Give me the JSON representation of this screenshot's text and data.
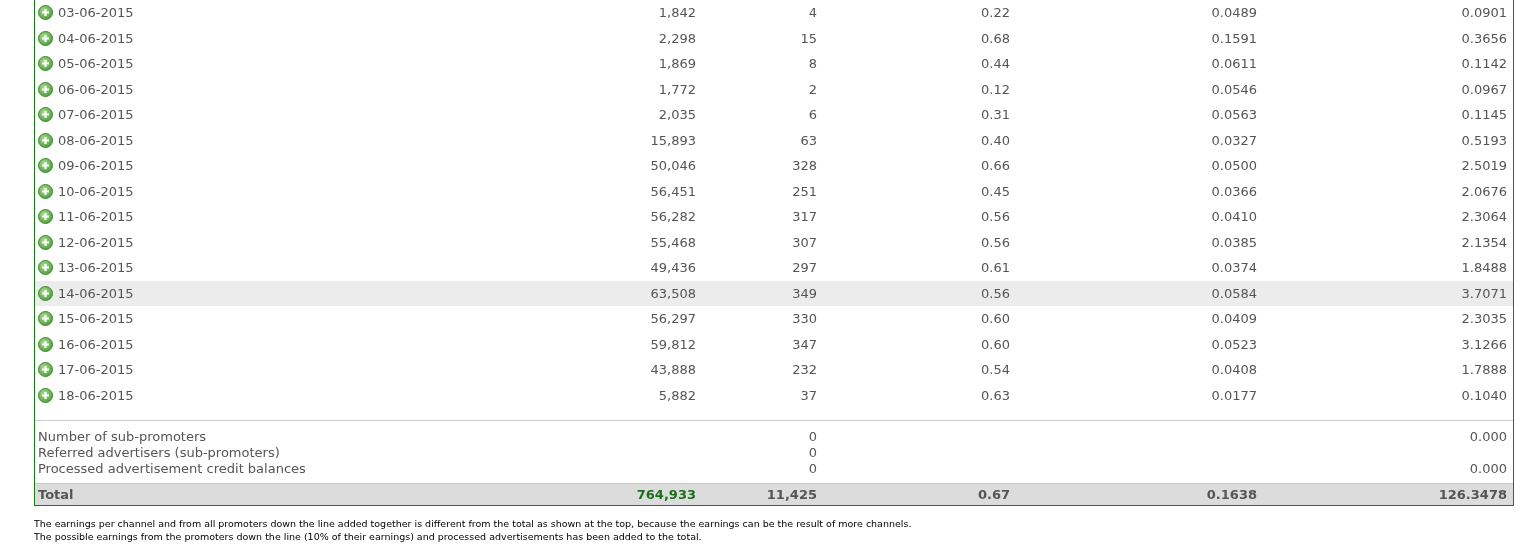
{
  "rows": [
    {
      "date": "03-06-2015",
      "cells": [
        "1,842",
        "4",
        "0.22",
        "0.0489",
        "0.0901"
      ],
      "highlighted": false
    },
    {
      "date": "04-06-2015",
      "cells": [
        "2,298",
        "15",
        "0.68",
        "0.1591",
        "0.3656"
      ],
      "highlighted": false
    },
    {
      "date": "05-06-2015",
      "cells": [
        "1,869",
        "8",
        "0.44",
        "0.0611",
        "0.1142"
      ],
      "highlighted": false
    },
    {
      "date": "06-06-2015",
      "cells": [
        "1,772",
        "2",
        "0.12",
        "0.0546",
        "0.0967"
      ],
      "highlighted": false
    },
    {
      "date": "07-06-2015",
      "cells": [
        "2,035",
        "6",
        "0.31",
        "0.0563",
        "0.1145"
      ],
      "highlighted": false
    },
    {
      "date": "08-06-2015",
      "cells": [
        "15,893",
        "63",
        "0.40",
        "0.0327",
        "0.5193"
      ],
      "highlighted": false
    },
    {
      "date": "09-06-2015",
      "cells": [
        "50,046",
        "328",
        "0.66",
        "0.0500",
        "2.5019"
      ],
      "highlighted": false
    },
    {
      "date": "10-06-2015",
      "cells": [
        "56,451",
        "251",
        "0.45",
        "0.0366",
        "2.0676"
      ],
      "highlighted": false
    },
    {
      "date": "11-06-2015",
      "cells": [
        "56,282",
        "317",
        "0.56",
        "0.0410",
        "2.3064"
      ],
      "highlighted": false
    },
    {
      "date": "12-06-2015",
      "cells": [
        "55,468",
        "307",
        "0.56",
        "0.0385",
        "2.1354"
      ],
      "highlighted": false
    },
    {
      "date": "13-06-2015",
      "cells": [
        "49,436",
        "297",
        "0.61",
        "0.0374",
        "1.8488"
      ],
      "highlighted": false
    },
    {
      "date": "14-06-2015",
      "cells": [
        "63,508",
        "349",
        "0.56",
        "0.0584",
        "3.7071"
      ],
      "highlighted": true
    },
    {
      "date": "15-06-2015",
      "cells": [
        "56,297",
        "330",
        "0.60",
        "0.0409",
        "2.3035"
      ],
      "highlighted": false
    },
    {
      "date": "16-06-2015",
      "cells": [
        "59,812",
        "347",
        "0.60",
        "0.0523",
        "3.1266"
      ],
      "highlighted": false
    },
    {
      "date": "17-06-2015",
      "cells": [
        "43,888",
        "232",
        "0.54",
        "0.0408",
        "1.7888"
      ],
      "highlighted": false
    },
    {
      "date": "18-06-2015",
      "cells": [
        "5,882",
        "37",
        "0.63",
        "0.0177",
        "0.1040"
      ],
      "highlighted": false
    }
  ],
  "extras": [
    {
      "label": "Number of sub-promoters",
      "column_2": "0",
      "column_5": "0.000"
    },
    {
      "label": "Referred advertisers (sub-promoters)",
      "column_2": "0"
    },
    {
      "label": "Processed advertisement credit balances",
      "column_2": "0",
      "column_5": "0.000"
    }
  ],
  "total": {
    "label": "Total",
    "cells": [
      "764,933",
      "11,425",
      "0.67",
      "0.1638",
      "126.3478"
    ]
  },
  "notes": [
    "The earnings per channel and from all promoters down the line added together is different from the total as shown at the top, because the earnings can be the result of more channels.",
    "The possible earnings from the promoters down the line (10% of their earnings) and processed advertisements has been added to the total."
  ]
}
